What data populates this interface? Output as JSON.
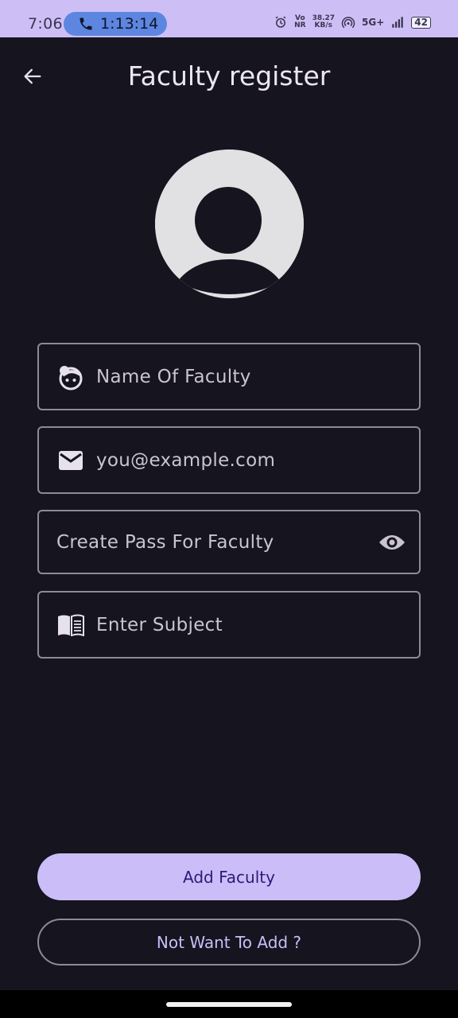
{
  "status_bar": {
    "time": "7:06",
    "call_duration": "1:13:14",
    "network_speed_top": "38.27",
    "network_speed_bottom": "KB/s",
    "volte_top": "Vo",
    "volte_bottom": "NR",
    "network_type": "5G+",
    "battery": "42"
  },
  "app_bar": {
    "title": "Faculty register"
  },
  "form": {
    "name_placeholder": "Name Of Faculty",
    "email_placeholder": "you@example.com",
    "password_placeholder": "Create Pass For Faculty",
    "subject_placeholder": "Enter Subject"
  },
  "actions": {
    "add_label": "Add Faculty",
    "cancel_label": "Not Want To Add ?"
  },
  "colors": {
    "background": "#15141f",
    "status_bar": "#cdbff6",
    "primary": "#cbbdf8",
    "outline": "#8e8a97"
  }
}
